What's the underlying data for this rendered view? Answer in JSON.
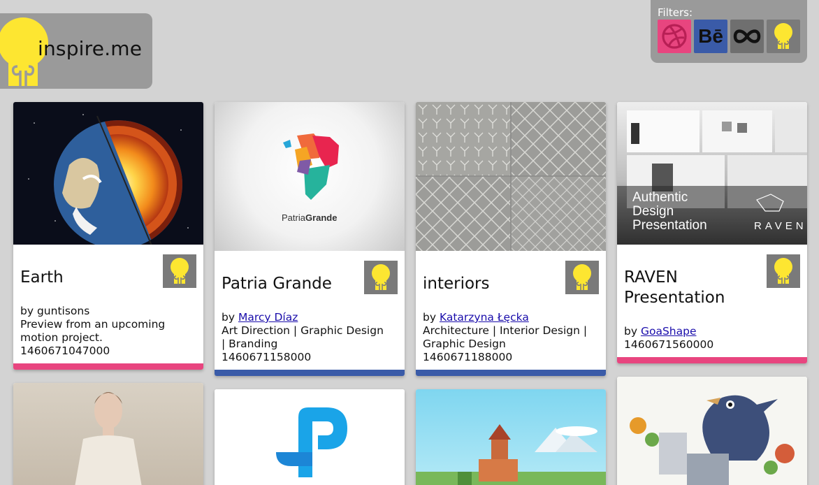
{
  "logo": {
    "text": "inspire.me",
    "icon": "lightbulb-icon"
  },
  "filters": {
    "label": "Filters:",
    "items": [
      {
        "name": "dribbble",
        "icon": "dribbble-icon",
        "color": "#e8457f"
      },
      {
        "name": "behance",
        "icon": "behance-icon",
        "label": "Bē",
        "color": "#3a5ba8"
      },
      {
        "name": "infinity",
        "icon": "infinity-icon",
        "color": "#6f6f6f"
      },
      {
        "name": "inspire",
        "icon": "lightbulb-icon",
        "color": "#7a7a7a"
      }
    ]
  },
  "cards": [
    {
      "title": "Earth",
      "by_prefix": "by ",
      "author": "guntisons",
      "description": "Preview from an upcoming motion project.",
      "timestamp": "1460671047000",
      "source_color": "#e8457f"
    },
    {
      "title": "Patria Grande",
      "by_prefix": "by ",
      "author": "Marcy Díaz",
      "description": "Art Direction | Graphic Design | Branding",
      "timestamp": "1460671158000",
      "source_color": "#3a5ba8",
      "image_text": {
        "a": "Patria",
        "b": "Grande"
      }
    },
    {
      "title": "interiors",
      "by_prefix": "by ",
      "author": "Katarzyna Łęcka",
      "description": "Architecture | Interior Design | Graphic Design",
      "timestamp": "1460671188000",
      "source_color": "#3a5ba8"
    },
    {
      "title": "RAVEN Presentation",
      "by_prefix": "by ",
      "author": "GoaShape",
      "timestamp": "1460671560000",
      "source_color": "#e8457f",
      "image_text": {
        "headline_1": "Authentic",
        "headline_2": "Design",
        "headline_3": "Presentation",
        "brand": "RAVEN"
      }
    }
  ],
  "colors": {
    "accent_yellow": "#fde631",
    "dribbble_pink": "#e8457f",
    "behance_blue": "#3a5ba8"
  }
}
